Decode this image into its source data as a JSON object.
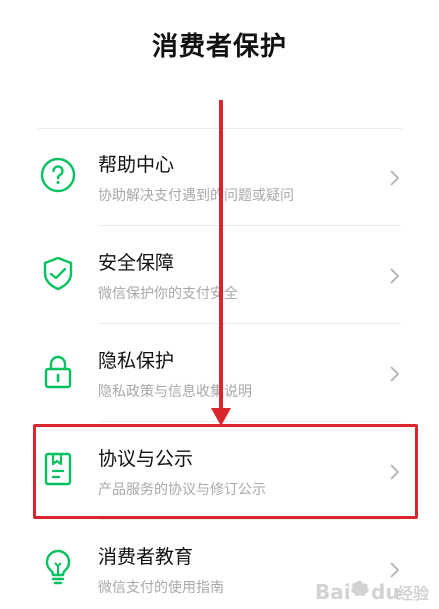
{
  "header": {
    "title": "消费者保护"
  },
  "menu": {
    "items": [
      {
        "label": "帮助中心",
        "desc": "协助解决支付遇到的问题或疑问",
        "icon": "help-circle-icon"
      },
      {
        "label": "安全保障",
        "desc": "微信保护你的支付安全",
        "icon": "shield-check-icon"
      },
      {
        "label": "隐私保护",
        "desc": "隐私政策与信息收集说明",
        "icon": "lock-icon"
      },
      {
        "label": "协议与公示",
        "desc": "产品服务的协议与修订公示",
        "icon": "document-icon"
      },
      {
        "label": "消费者教育",
        "desc": "微信支付的使用指南",
        "icon": "lightbulb-icon"
      }
    ]
  },
  "colors": {
    "accent": "#07c160",
    "annotation": "#d9252c"
  },
  "watermark": {
    "text": "Bai du 经验"
  }
}
